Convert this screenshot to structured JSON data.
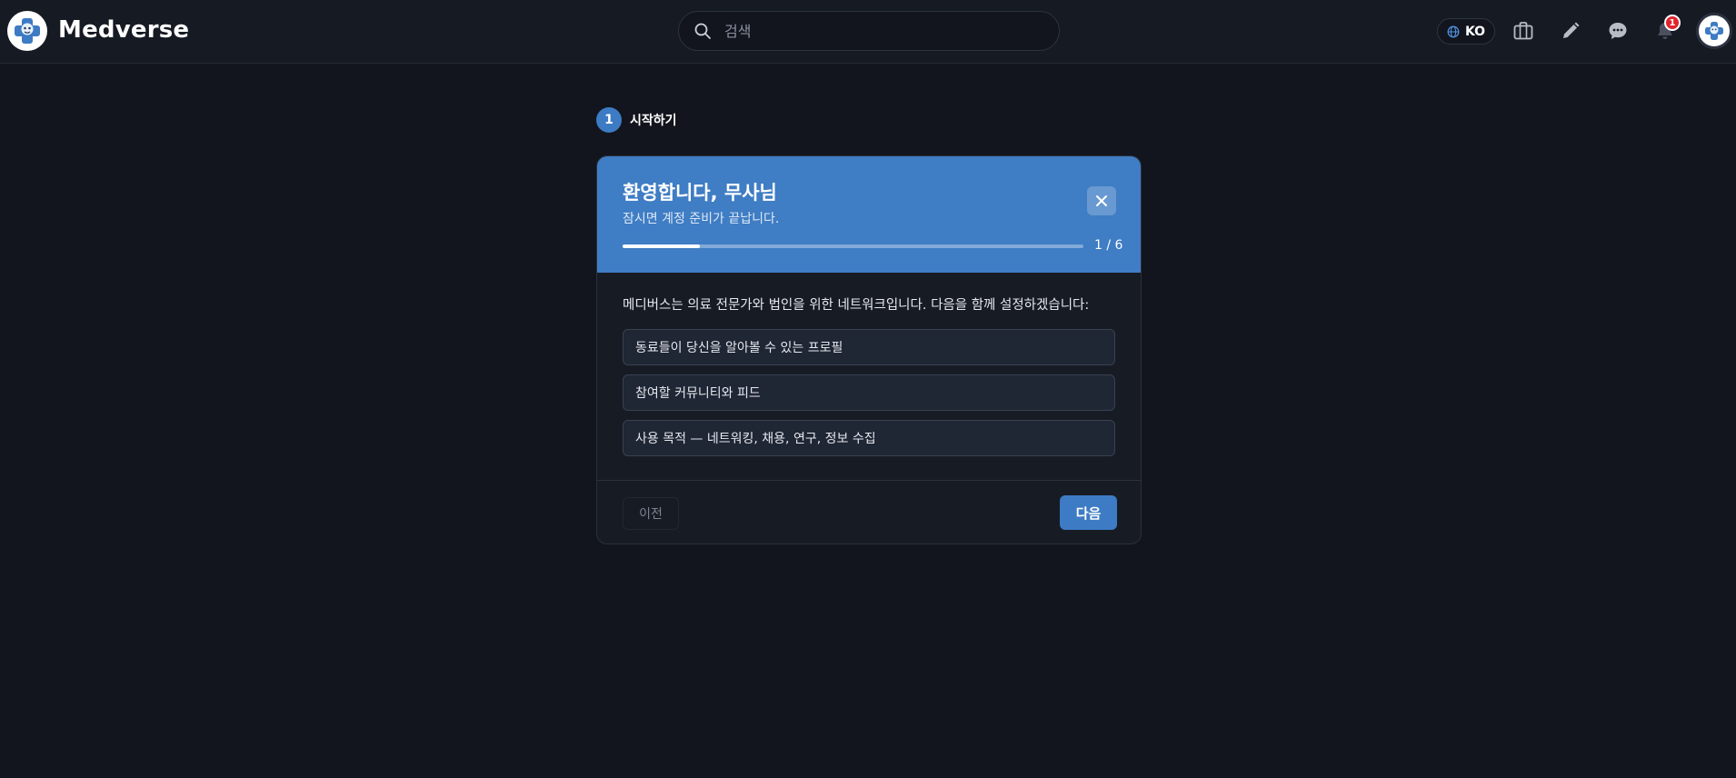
{
  "header": {
    "brand_name": "Medverse",
    "search": {
      "placeholder": "검색",
      "value": ""
    },
    "language": "KO",
    "notification_count": "1",
    "icons": {
      "logo": "medverse-logo-icon",
      "search": "search-icon",
      "language": "globe-icon",
      "jobs": "briefcase-icon",
      "compose": "pencil-icon",
      "messages": "chat-bubble-icon",
      "notifications": "bell-icon",
      "avatar": "user-avatar-icon"
    }
  },
  "stepper": {
    "step_number": "1",
    "step_label": "시작하기"
  },
  "onboarding": {
    "title": "환영합니다, 무사님",
    "subtitle": "잠시면 계정 준비가 끝납니다.",
    "progress": {
      "current": 1,
      "total": 6,
      "label": "1 / 6"
    },
    "intro": "메디버스는 의료 전문가와 법인을 위한 네트워크입니다. 다음을 함께 설정하겠습니다:",
    "items": [
      "동료들이 당신을 알아볼 수 있는 프로필",
      "참여할 커뮤니티와 피드",
      "사용 목적 — 네트워킹, 채용, 연구, 정보 수집"
    ],
    "prev_label": "이전",
    "next_label": "다음"
  },
  "colors": {
    "accent": "#3d7bc4",
    "header_band": "#3f7dc4",
    "background": "#12151d",
    "badge": "#e0242f"
  }
}
